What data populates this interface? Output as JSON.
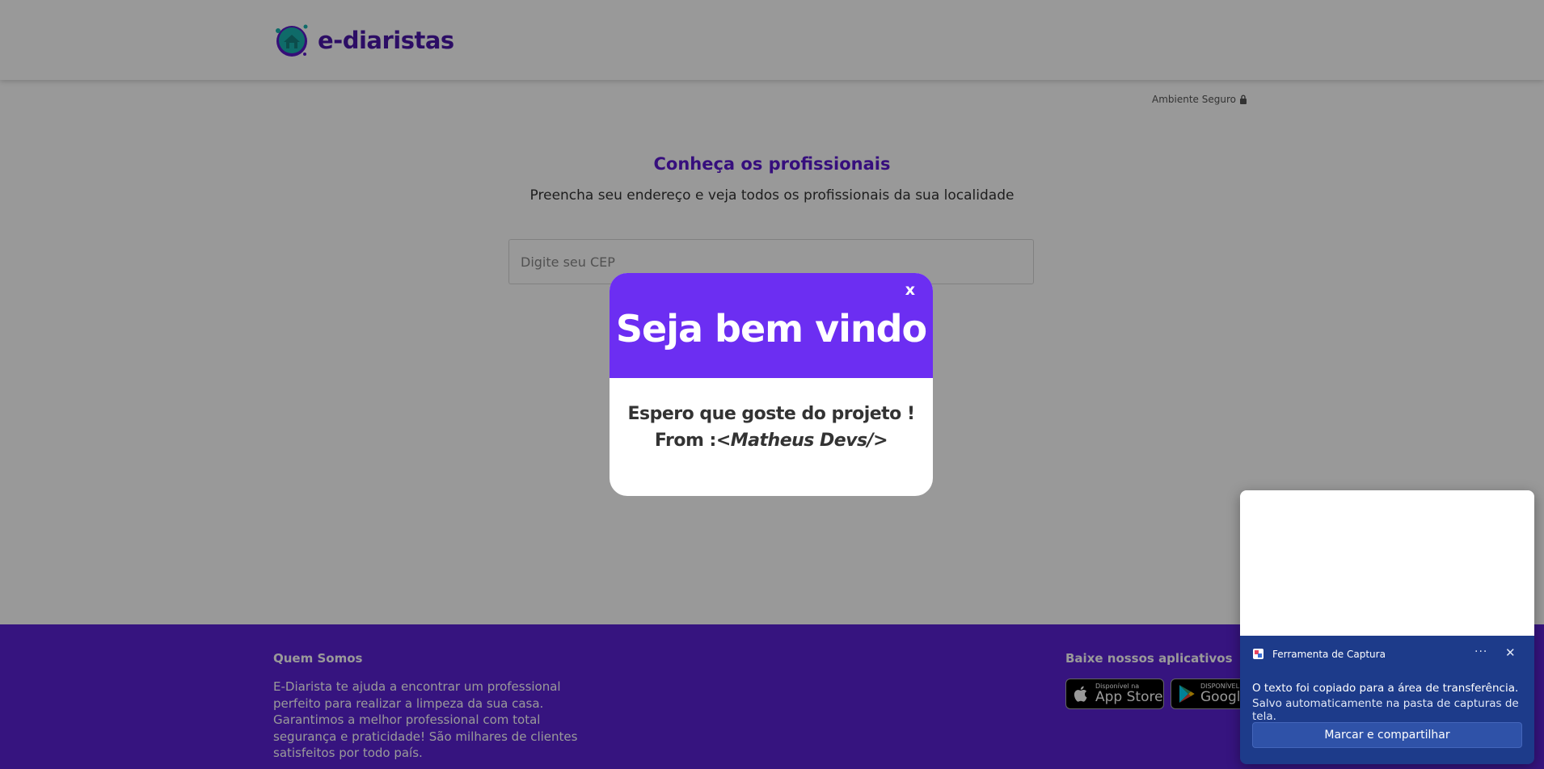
{
  "header": {
    "logo_text": "e-diaristas"
  },
  "secure_label": "Ambiente Seguro",
  "main": {
    "title": "Conheça os profissionais",
    "subtitle": "Preencha seu endereço e veja todos os profissionais da sua localidade",
    "cep_placeholder": "Digite seu CEP"
  },
  "footer": {
    "about_title": "Quem Somos",
    "about_text": "E-Diarista te ajuda a encontrar um professional perfeito para realizar a limpeza da sua casa. Garantimos a melhor professional com total segurança e praticidade! São milhares de clientes satisfeitos por todo país.",
    "apps_title": "Baixe nossos aplicativos",
    "app_store": {
      "small": "Disponível na",
      "big": "App Store"
    },
    "google_play": {
      "small": "DISPONÍVEL NO",
      "big": "Google Play"
    }
  },
  "modal": {
    "close_label": "x",
    "title": "Seja bem vindo",
    "line1": "Espero que goste do projeto !",
    "line2_prefix": "From :",
    "line2_signature": "<Matheus Devs/>"
  },
  "toast": {
    "app_name": "Ferramenta de Captura",
    "more_label": "···",
    "close_label": "✕",
    "message": "O texto foi copiado para a área de transferência.",
    "detail": "Salvo automaticamente na pasta de capturas de tela.",
    "button_label": "Marcar e compartilhar"
  },
  "colors": {
    "brand_purple": "#5a22d4",
    "modal_purple": "#6c2ef2",
    "toast_blue": "#1d3b8a"
  }
}
